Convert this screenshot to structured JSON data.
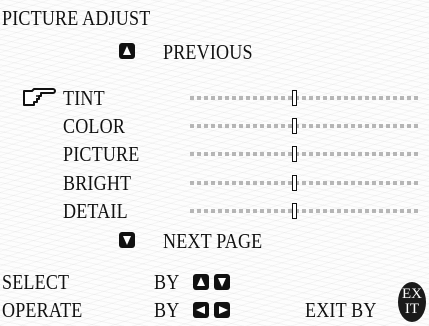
{
  "menu": {
    "title": "PICTURE ADJUST",
    "previous_label": "PREVIOUS",
    "next_label": "NEXT PAGE",
    "items": [
      {
        "label": "TINT",
        "level": 0.5,
        "selected": true
      },
      {
        "label": "COLOR",
        "level": 0.5,
        "selected": false
      },
      {
        "label": "PICTURE",
        "level": 0.5,
        "selected": false
      },
      {
        "label": "BRIGHT",
        "level": 0.5,
        "selected": false
      },
      {
        "label": "DETAIL",
        "level": 0.5,
        "selected": false
      }
    ]
  },
  "footer": {
    "select_label": "SELECT",
    "operate_label": "OPERATE",
    "by_label": "BY",
    "exit_label": "EXIT BY",
    "exit_button_line1": "EX",
    "exit_button_line2": "IT"
  },
  "icons": {
    "pointer": "pointing-hand-icon",
    "up": "up-arrow-button-icon",
    "down": "down-arrow-button-icon",
    "left": "left-arrow-button-icon",
    "right": "right-arrow-button-icon"
  }
}
